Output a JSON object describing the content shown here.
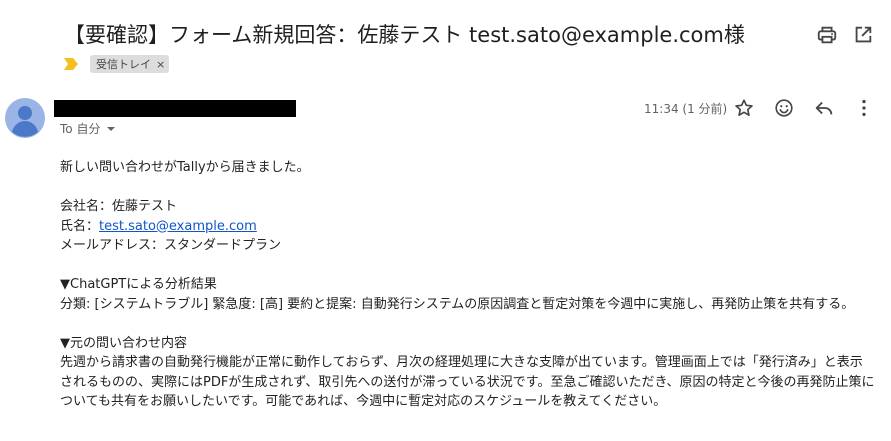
{
  "subject": "【要確認】フォーム新規回答：佐藤テスト test.sato@example.com様",
  "label": {
    "name": "受信トレイ",
    "remove_glyph": "×",
    "importance_color": "#f4c01e"
  },
  "sender": {
    "recipient": "To 自分"
  },
  "time": "11:34 (1 分前)",
  "body": {
    "intro": "新しい問い合わせがTallyから届きました。",
    "company_line": "会社名：佐藤テスト",
    "name_prefix": "氏名：",
    "name_email": "test.sato@example.com",
    "email_line": "メールアドレス：スタンダードプラン",
    "analysis_heading": "▼ChatGPTによる分析結果",
    "analysis_text": "分類: [システムトラブル] 緊急度: [高] 要約と提案: 自動発行システムの原因調査と暫定対策を今週中に実施し、再発防止策を共有する。",
    "original_heading": "▼元の問い合わせ内容",
    "original_text": "先週から請求書の自動発行機能が正常に動作しておらず、月次の経理処理に大きな支障が出ています。管理画面上では「発行済み」と表示されるものの、実際にはPDFが生成されず、取引先への送付が滞っている状況です。至急ご確認いただき、原因の特定と今後の再発防止策についても共有をお願いしたいです。可能であれば、今週中に暫定対応のスケジュールを教えてください。"
  },
  "icons": {
    "print": "print-icon",
    "popout": "open-in-new-window-icon",
    "star": "star-icon",
    "emoji": "emoji-reaction-icon",
    "reply": "reply-icon",
    "more": "more-vertical-icon",
    "avatar": "default-avatar-icon",
    "importance": "importance-marker-icon"
  },
  "colors": {
    "link": "#1155cc",
    "avatar": "#9ab4e6",
    "label_chip": "#dddddd"
  }
}
